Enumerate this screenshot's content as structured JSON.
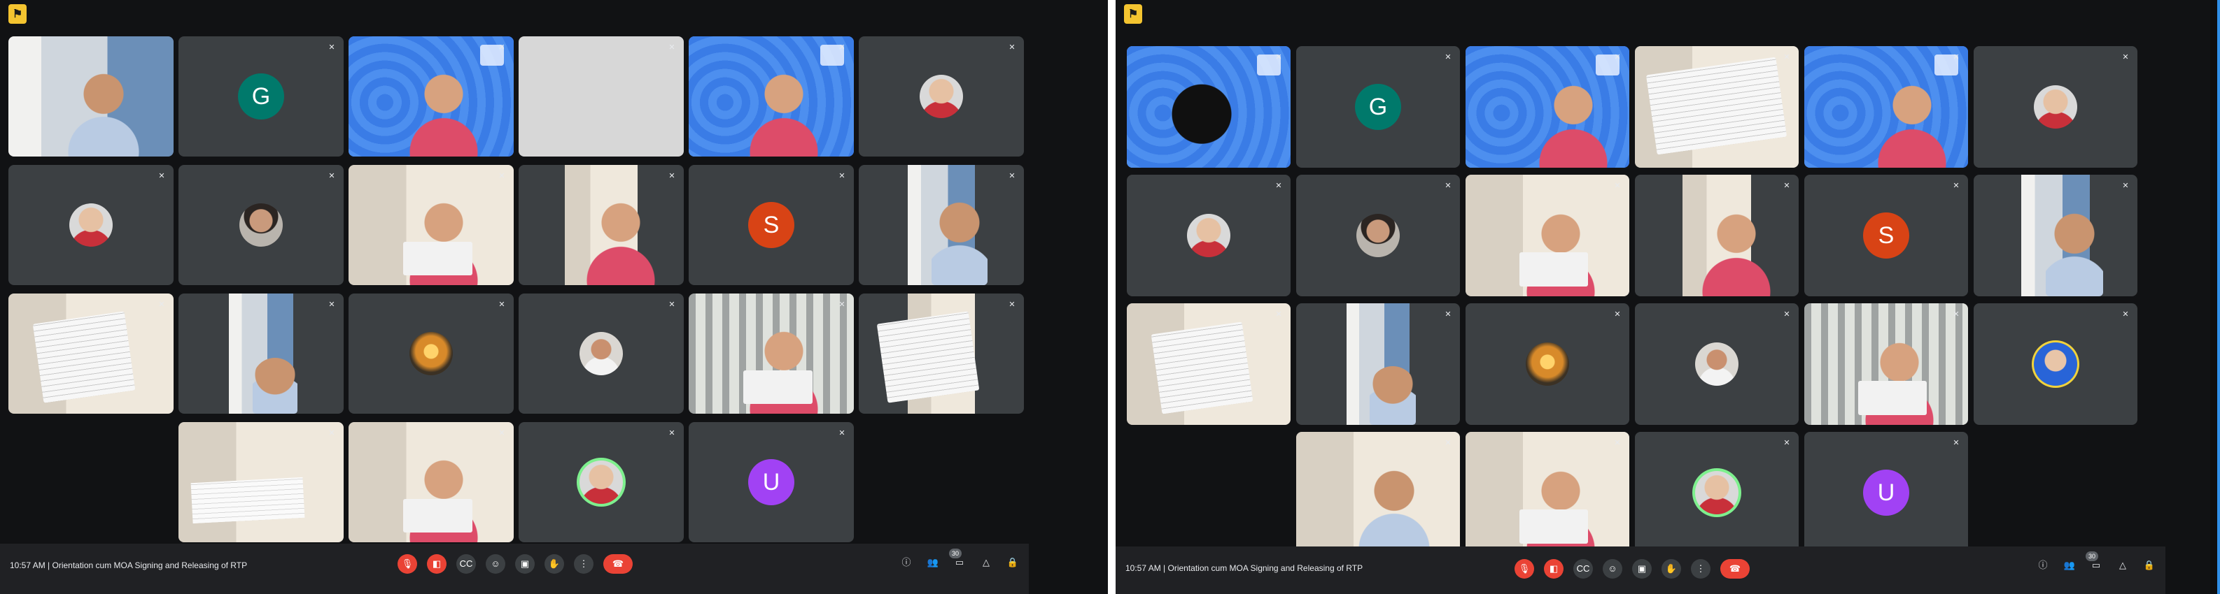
{
  "screens": [
    {
      "time": "10:57 AM",
      "meeting_title": "Orientation cum MOA Signing and Releasing of RTP",
      "participant_badge": "30"
    },
    {
      "time": "10:57 AM",
      "meeting_title": "Orientation cum MOA Signing and Releasing of RTP",
      "participant_badge": "30"
    }
  ],
  "avatars": {
    "g": "G",
    "s": "S",
    "u": "U"
  },
  "colors": {
    "meet_background": "#111214",
    "tile": "#3c4043",
    "bar": "#202124",
    "teal_avatar": "#00796b",
    "orange_avatar": "#d84315",
    "purple_avatar": "#a142f4",
    "end_call": "#ea4335",
    "active_frame": "#8ab4f8"
  },
  "icons": [
    "present-flag-icon",
    "mic-off-icon",
    "camera-off-icon",
    "captions-icon",
    "emoji-icon",
    "present-screen-icon",
    "raise-hand-icon",
    "more-options-icon",
    "end-call-icon",
    "info-icon",
    "people-icon",
    "chat-icon",
    "activities-icon",
    "lock-icon"
  ]
}
